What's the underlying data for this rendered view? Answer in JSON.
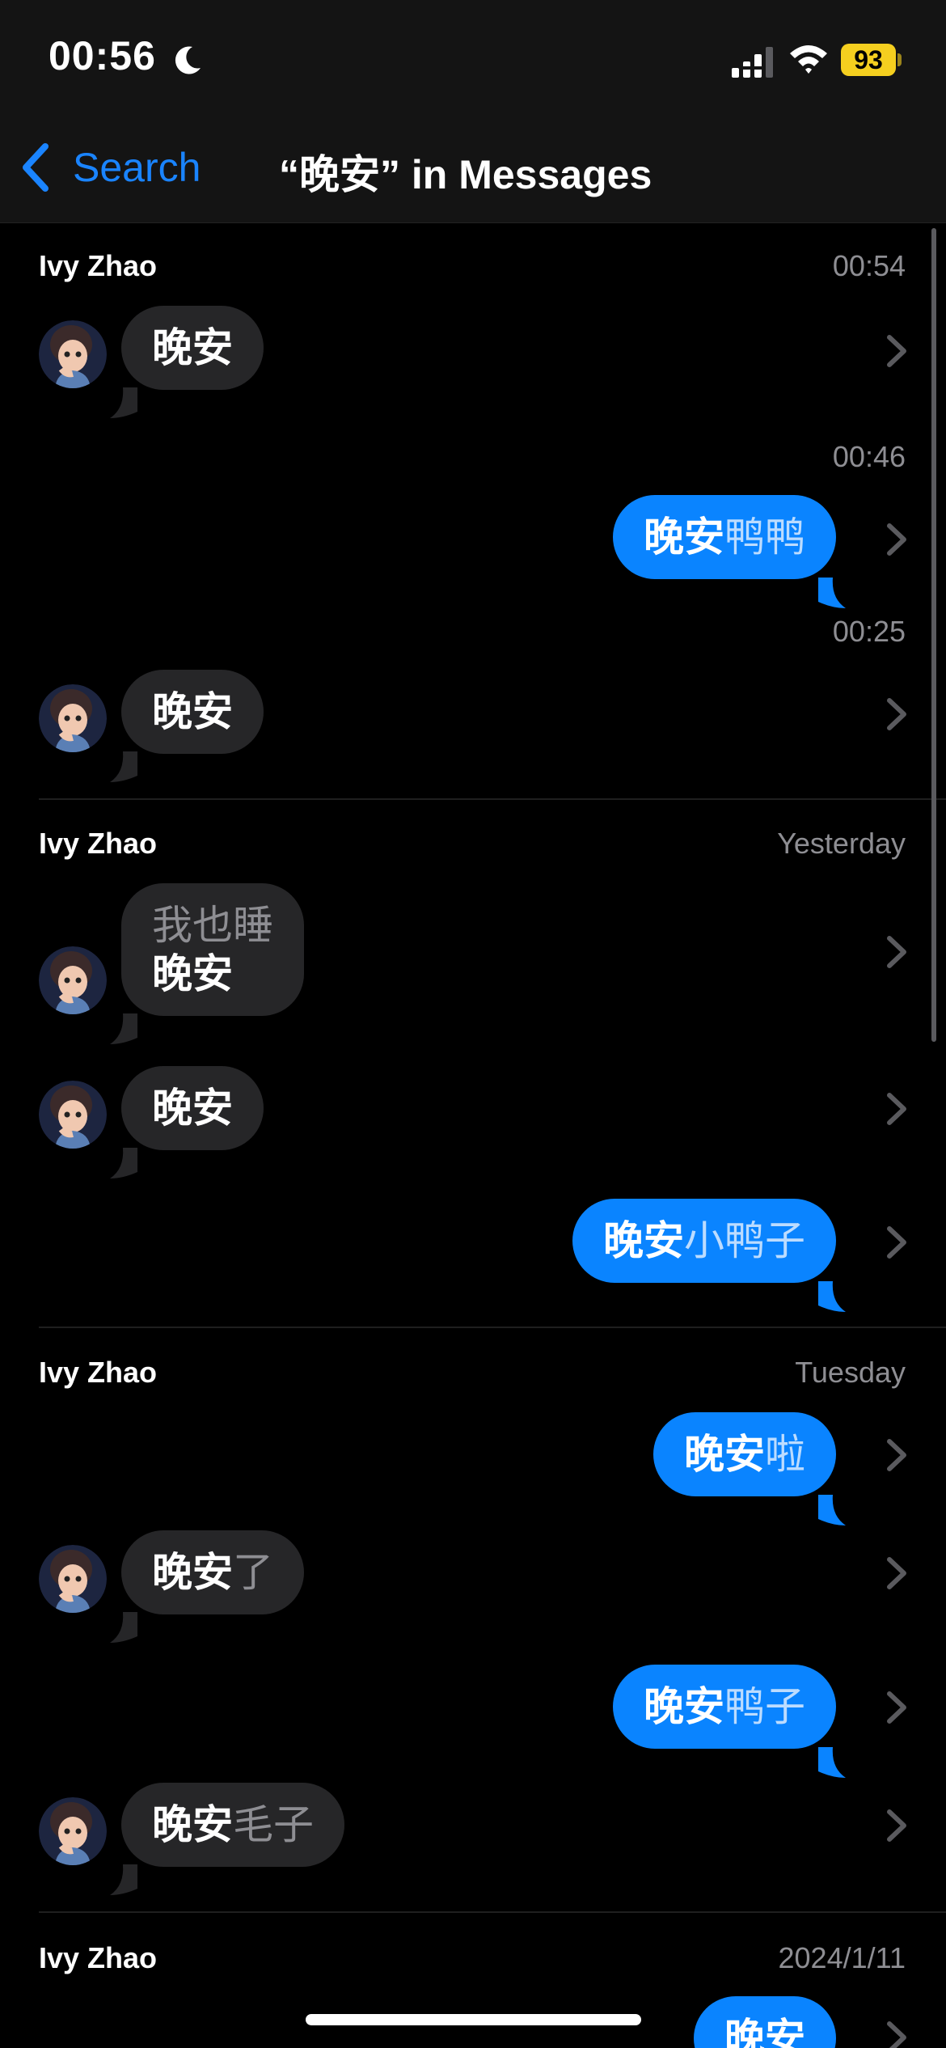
{
  "status_bar": {
    "time": "00:56",
    "battery": "93",
    "icons": [
      "moon-icon",
      "cellular-signal-icon",
      "wifi-icon",
      "battery-icon"
    ]
  },
  "nav": {
    "back_label": "Search",
    "title": "“晚安” in Messages"
  },
  "colors": {
    "accent": "#0a84ff",
    "incoming_bubble": "#262628",
    "background": "#000000",
    "nav_background": "#141414",
    "battery": "#f5cf1f"
  },
  "sections": [
    {
      "name": "Ivy Zhao",
      "date": "00:54",
      "messages": [
        {
          "dir": "in",
          "highlight": "晚安",
          "rest": ""
        },
        {
          "dir": "out",
          "time": "00:46",
          "highlight": "晚安",
          "rest": "鸭鸭"
        },
        {
          "dir": "in",
          "time": "00:25",
          "highlight": "晚安",
          "rest": ""
        }
      ]
    },
    {
      "name": "Ivy Zhao",
      "date": "Yesterday",
      "messages": [
        {
          "dir": "in",
          "pre": "我也睡",
          "highlight": "晚安",
          "rest": ""
        },
        {
          "dir": "in",
          "highlight": "晚安",
          "rest": ""
        },
        {
          "dir": "out",
          "highlight": "晚安",
          "rest": "小鸭子"
        }
      ]
    },
    {
      "name": "Ivy Zhao",
      "date": "Tuesday",
      "messages": [
        {
          "dir": "out",
          "highlight": "晚安",
          "rest": "啦"
        },
        {
          "dir": "in",
          "highlight": "晚安",
          "rest": "了"
        },
        {
          "dir": "out",
          "highlight": "晚安",
          "rest": "鸭子"
        },
        {
          "dir": "in",
          "highlight": "晚安",
          "rest": "毛子"
        }
      ]
    },
    {
      "name": "Ivy Zhao",
      "date": "2024/1/11",
      "messages": [
        {
          "dir": "out",
          "highlight": "晚安",
          "rest": ""
        }
      ]
    }
  ]
}
